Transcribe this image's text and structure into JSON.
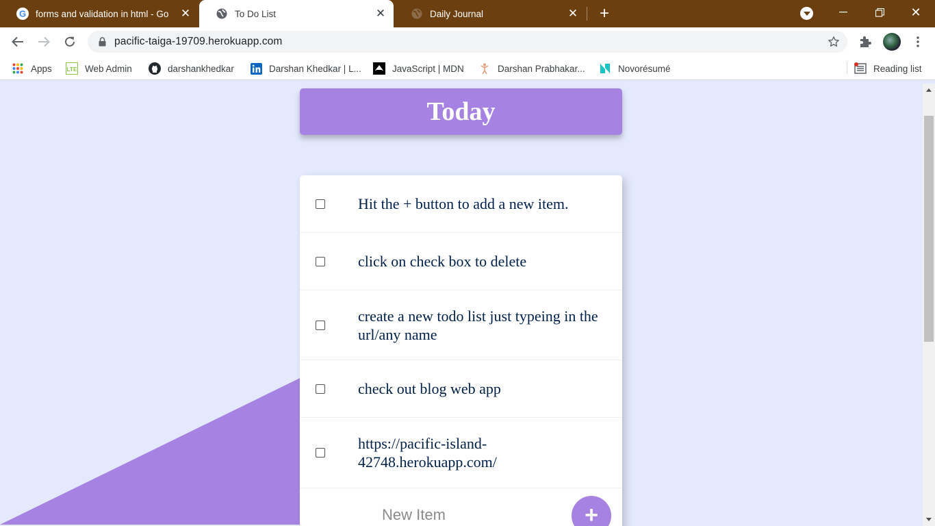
{
  "browser": {
    "tabs": [
      {
        "title": "forms and validation in html - Go",
        "favicon": "google-icon",
        "active": false
      },
      {
        "title": "To Do List",
        "favicon": "globe-icon",
        "active": true
      },
      {
        "title": "Daily Journal",
        "favicon": "globe-icon",
        "active": false
      }
    ],
    "address": {
      "url": "pacific-taiga-19709.herokuapp.com"
    },
    "bookmarks": [
      {
        "label": "Apps",
        "icon": "apps-grid-icon"
      },
      {
        "label": "Web Admin",
        "icon": "lte-icon"
      },
      {
        "label": "darshankhedkar",
        "icon": "github-icon"
      },
      {
        "label": "Darshan Khedkar | L...",
        "icon": "linkedin-icon"
      },
      {
        "label": "JavaScript | MDN",
        "icon": "mdn-icon"
      },
      {
        "label": "Darshan Prabhakar...",
        "icon": "person-icon"
      },
      {
        "label": "Novorésumé",
        "icon": "novoresume-icon"
      }
    ],
    "reading_list": "Reading list"
  },
  "page": {
    "heading": "Today",
    "items": [
      {
        "text": "Hit the + button to add a new item."
      },
      {
        "text": "click on check box to delete"
      },
      {
        "text": "create a new todo list just typeing in the url/any name"
      },
      {
        "text": "check out blog web app"
      },
      {
        "text": "https://pacific-island-42748.herokuapp.com/"
      }
    ],
    "new_item_placeholder": "New Item",
    "add_button_label": "+"
  },
  "colors": {
    "accent": "#a683e3",
    "background": "#e4e9fd",
    "tabstrip": "#6b3f0f",
    "text": "#00204a"
  }
}
